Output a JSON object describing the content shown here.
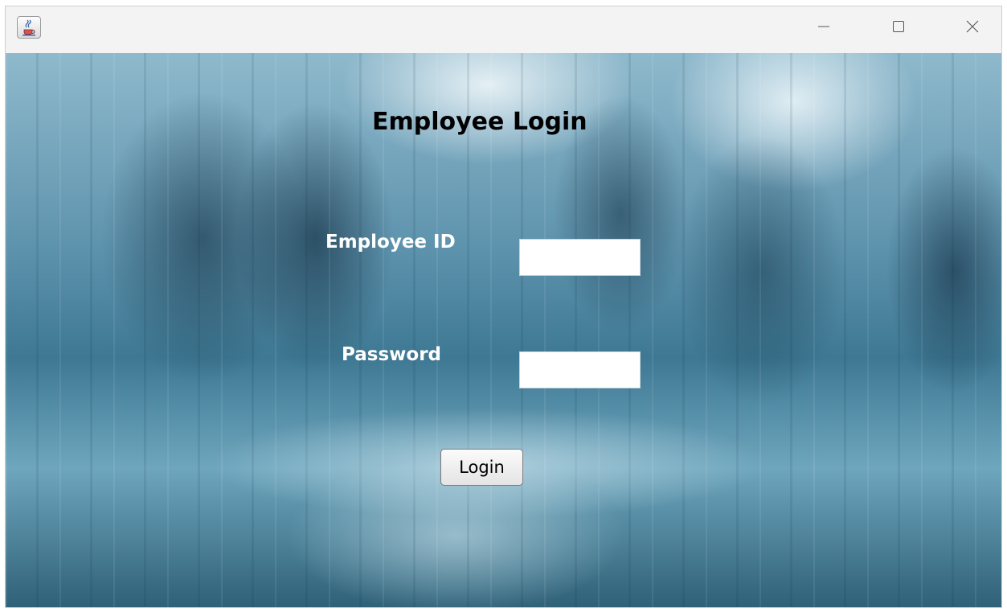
{
  "window": {
    "app_icon": "java-cup-icon",
    "controls": {
      "minimize_icon": "minimize-icon",
      "maximize_icon": "maximize-icon",
      "close_icon": "close-icon"
    }
  },
  "form": {
    "title": "Employee Login",
    "employee_id_label": "Employee ID",
    "employee_id_value": "",
    "password_label": "Password",
    "password_value": "",
    "login_button": "Login"
  },
  "colors": {
    "title_text": "#000000",
    "label_text": "#ffffff",
    "titlebar": "#f3f3f3",
    "background_tint": "#3e7893"
  }
}
